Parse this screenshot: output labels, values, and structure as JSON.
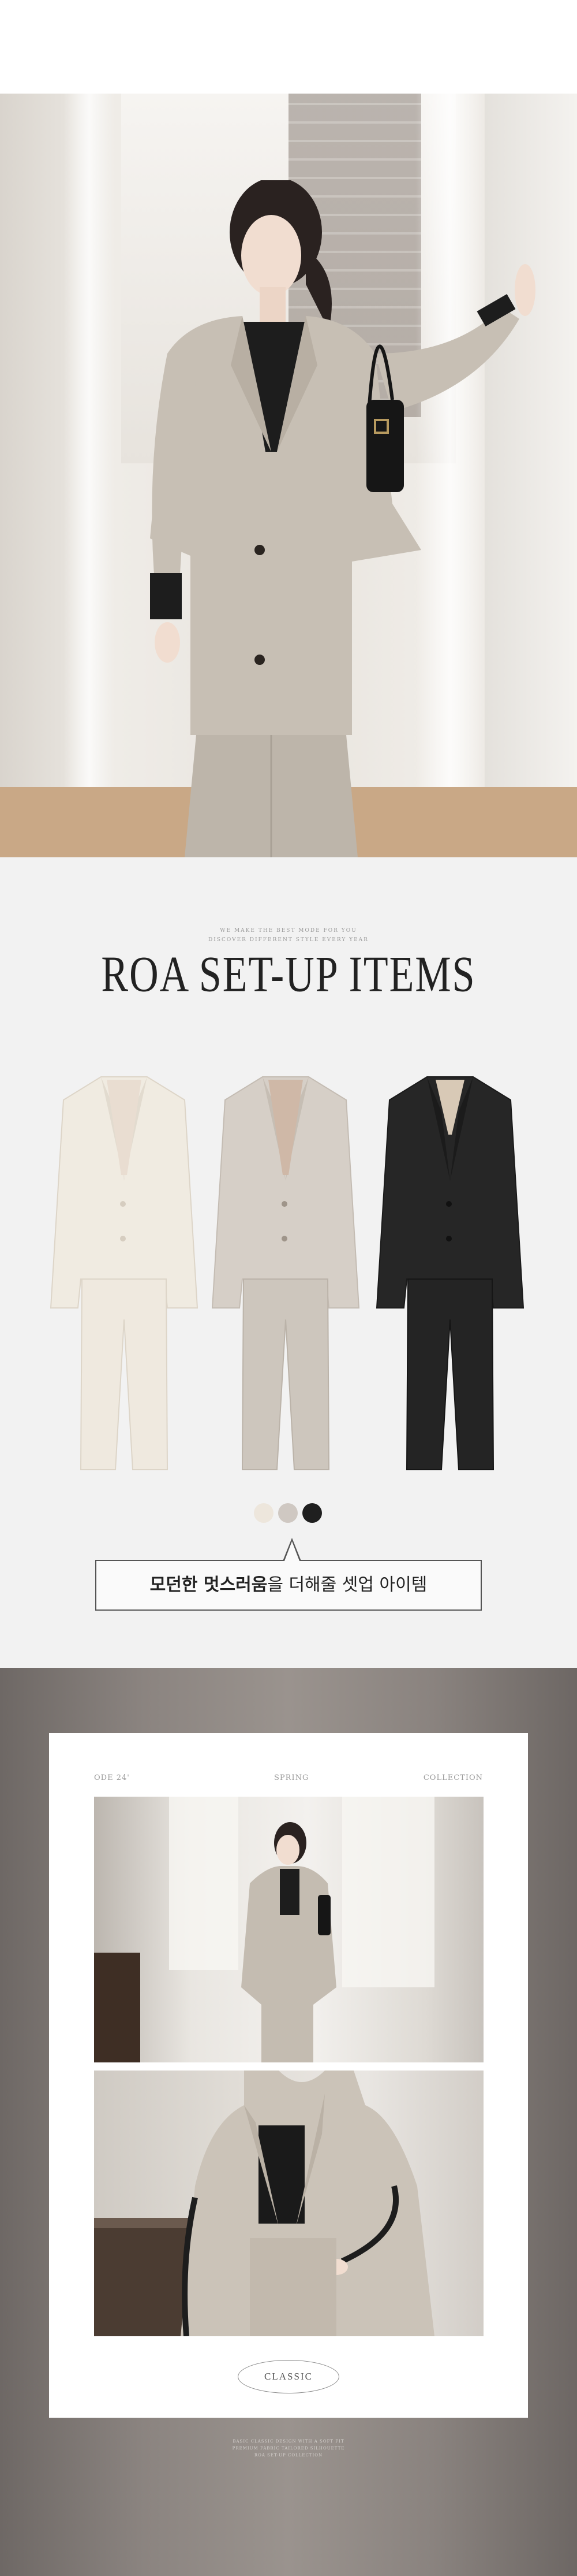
{
  "items": {
    "small_lines": [
      "WE MAKE THE BEST MODE FOR YOU",
      "DISCOVER DIFFERENT STYLE EVERY YEAR"
    ],
    "title": "ROA SET-UP ITEMS",
    "swatches": [
      "#ede6dc",
      "#cfc8c2",
      "#1f1f1f"
    ],
    "callout_bold": "모던한 멋스러움",
    "callout_rest": "을 더해줄 셋업 아이템"
  },
  "card": {
    "label_left": "ODE 24'",
    "label_center": "SPRING",
    "label_right": "COLLECTION",
    "badge": "CLASSIC"
  },
  "footer": {
    "lines": [
      "BASIC CLASSIC DESIGN WITH A SOFT FIT",
      "PREMIUM FABRIC TAILORED SILHOUETTE",
      "ROA SET-UP COLLECTION"
    ]
  }
}
